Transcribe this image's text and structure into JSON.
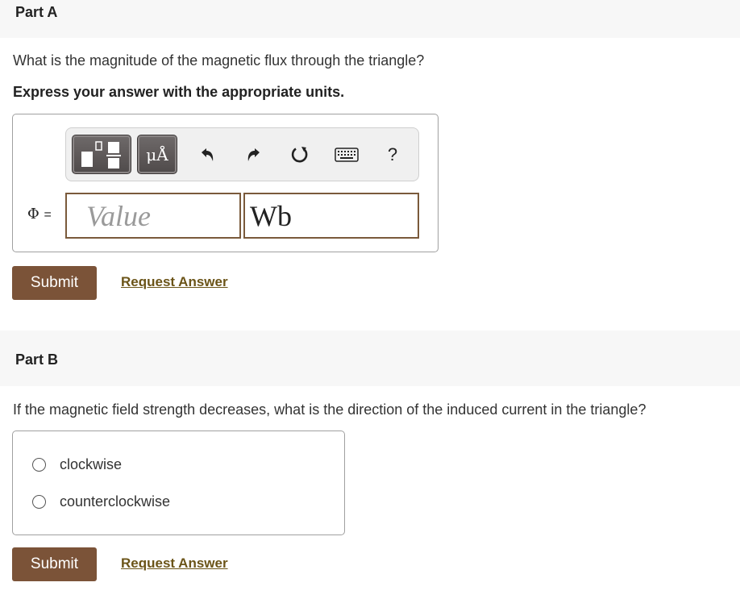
{
  "partA": {
    "title": "Part A",
    "question": "What is the magnitude of the magnetic flux through the triangle?",
    "instruction": "Express your answer with the appropriate units.",
    "toolbar": {
      "units_label": "μÅ",
      "help_label": "?",
      "icons": [
        "templates-icon",
        "units-icon",
        "undo-icon",
        "redo-icon",
        "reset-icon",
        "keyboard-icon",
        "help-icon"
      ]
    },
    "variable_label": "Φ",
    "equals": "=",
    "value_placeholder": "Value",
    "value": "",
    "unit": "Wb",
    "submit_label": "Submit",
    "request_label": "Request Answer"
  },
  "partB": {
    "title": "Part B",
    "question": "If the magnetic field strength decreases, what is the direction of the induced current in the triangle?",
    "options": [
      {
        "label": "clockwise",
        "selected": false
      },
      {
        "label": "counterclockwise",
        "selected": false
      }
    ],
    "submit_label": "Submit",
    "request_label": "Request Answer"
  },
  "colors": {
    "submit_bg": "#7b5338",
    "link": "#6b5418",
    "input_border": "#7a5a3b",
    "header_bg": "#f7f7f7"
  }
}
